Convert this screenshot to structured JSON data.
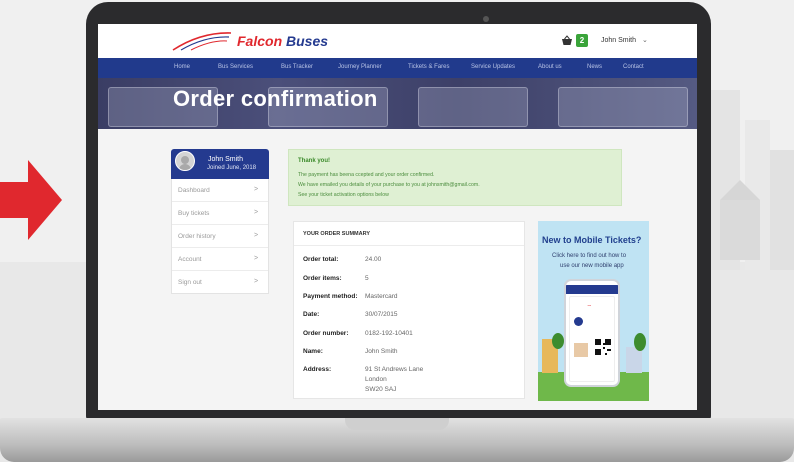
{
  "header": {
    "logo_part1": "Falcon",
    "logo_part2": "Buses",
    "basket_count": "2",
    "user_name": "John Smith",
    "user_caret": "⌄"
  },
  "nav": {
    "items": [
      {
        "label": "Home"
      },
      {
        "label": "Bus Services"
      },
      {
        "label": "Bus Tracker"
      },
      {
        "label": "Journey Planner"
      },
      {
        "label": "Tickets & Fares"
      },
      {
        "label": "Service Updates"
      },
      {
        "label": "About us"
      },
      {
        "label": "News"
      },
      {
        "label": "Contact"
      }
    ]
  },
  "hero": {
    "title": "Order confirmation"
  },
  "profile": {
    "name": "John Smith",
    "joined": "Joined June, 2018"
  },
  "sidebar": {
    "items": [
      {
        "label": "Dashboard"
      },
      {
        "label": "Buy tickets"
      },
      {
        "label": "Order history"
      },
      {
        "label": "Account"
      },
      {
        "label": "Sign out"
      }
    ],
    "chevron": ">"
  },
  "alert": {
    "title": "Thank you!",
    "lines": [
      "The payment has beena ccepted and your order confirmed.",
      "We have emailed you details of your purchase to you at johnsmith@gmail.com.",
      "See your ticket activation options below"
    ]
  },
  "summary": {
    "title": "YOUR ORDER SUMMARY",
    "rows": [
      {
        "label": "Order total:",
        "value": "24.00"
      },
      {
        "label": "Order items:",
        "value": "5"
      },
      {
        "label": "Payment method:",
        "value": "Mastercard"
      },
      {
        "label": "Date:",
        "value": "30/07/2015"
      },
      {
        "label": "Order number:",
        "value": "0182-192-10401"
      },
      {
        "label": "Name:",
        "value": "John Smith"
      },
      {
        "label": "Address:",
        "value": "91 St Andrews Lane"
      }
    ],
    "address_extra": [
      "London",
      "SW20 SAJ"
    ]
  },
  "promo": {
    "title": "New to Mobile Tickets?",
    "line1": "Click here to find out how to",
    "line2": "use our new mobile app"
  },
  "colors": {
    "brand_blue": "#243a8f",
    "brand_red": "#e0282e",
    "success_green": "#3aa43a"
  }
}
